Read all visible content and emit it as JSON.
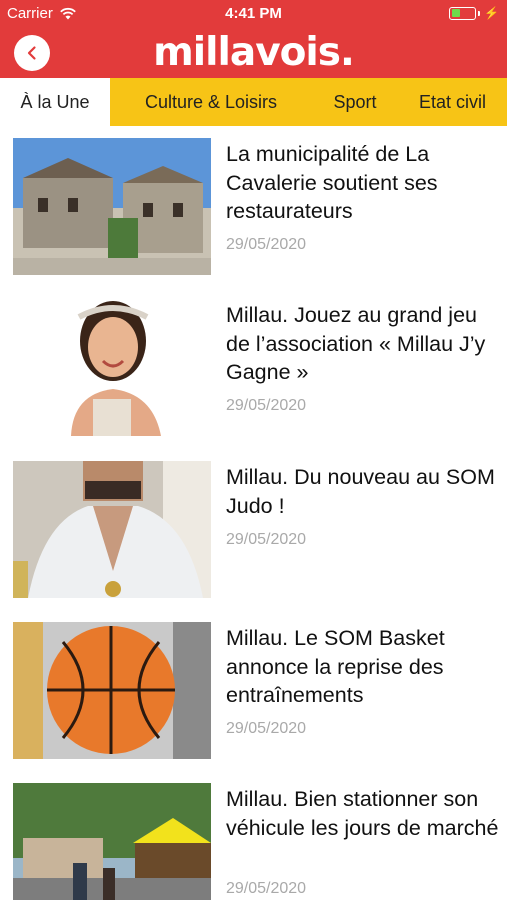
{
  "status_bar": {
    "carrier": "Carrier",
    "time": "4:41 PM"
  },
  "header": {
    "logo": "millavois.",
    "brand_color": "#e23b3b"
  },
  "tabs": [
    {
      "label": "À la Une",
      "active": true
    },
    {
      "label": "Culture & Loisirs",
      "active": false
    },
    {
      "label": "Sport",
      "active": false
    },
    {
      "label": "Etat civil",
      "active": false
    }
  ],
  "tab_color": "#f7c416",
  "articles": [
    {
      "title": "La municipalité de La Cavalerie soutient ses restaurateurs",
      "date": "29/05/2020"
    },
    {
      "title": "Millau. Jouez au grand jeu de l’association « Millau J’y Gagne »",
      "date": "29/05/2020"
    },
    {
      "title": "Millau. Du nouveau au SOM Judo !",
      "date": "29/05/2020"
    },
    {
      "title": "Millau. Le SOM Basket annonce la reprise des entraînements",
      "date": "29/05/2020"
    },
    {
      "title": "Millau. Bien stationner son véhicule les jours de marché",
      "date": "29/05/2020"
    }
  ]
}
